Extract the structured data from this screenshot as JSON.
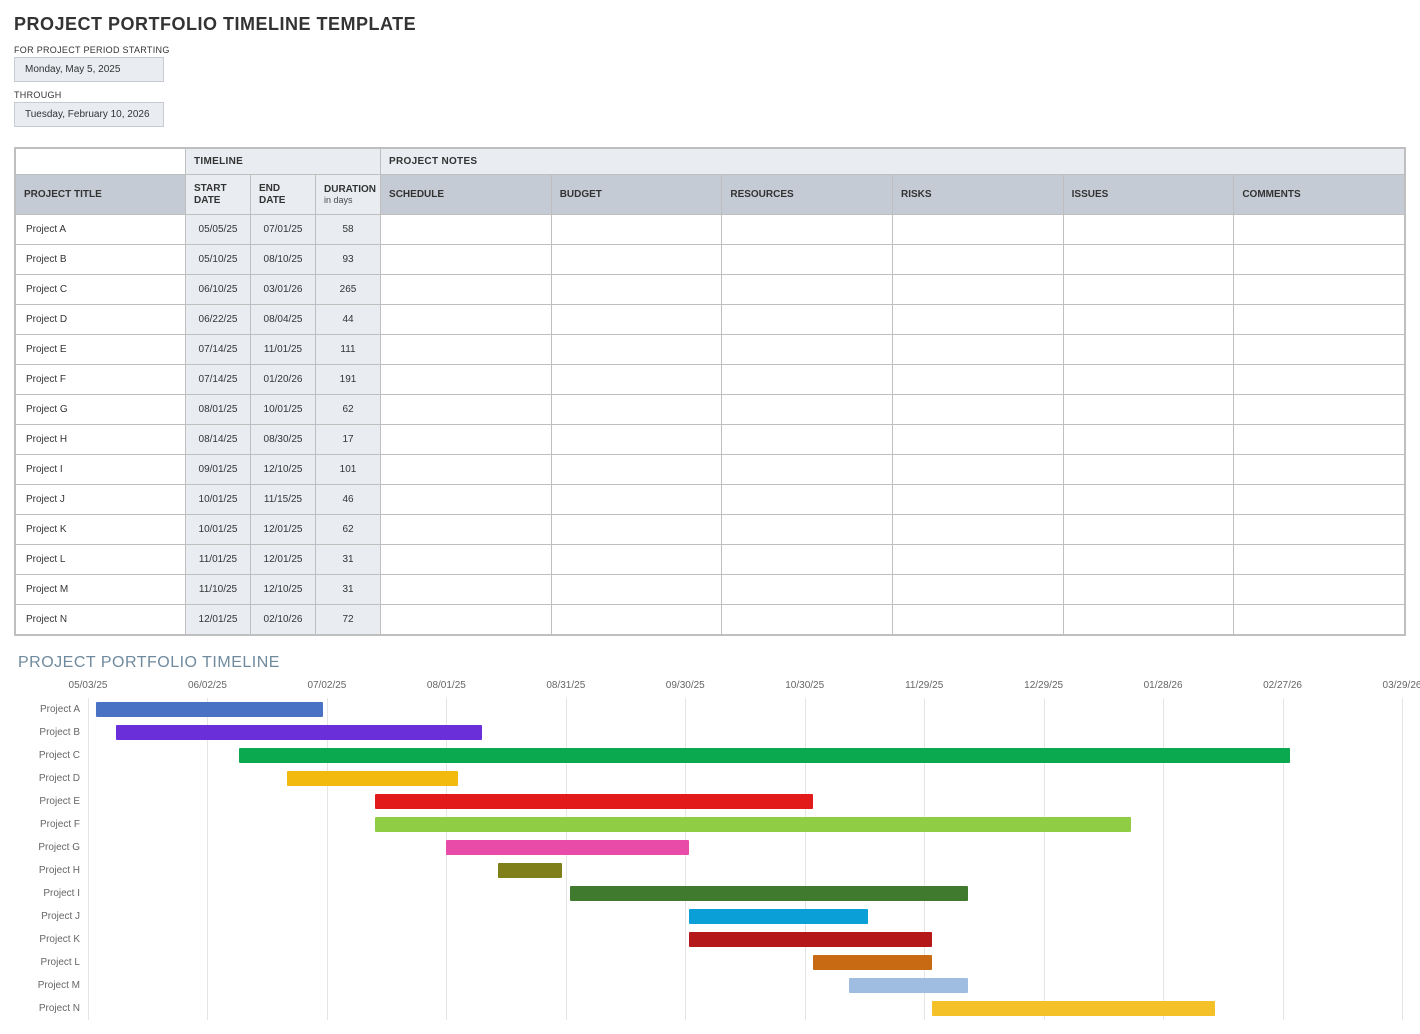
{
  "header": {
    "title": "PROJECT PORTFOLIO TIMELINE TEMPLATE",
    "period_label_start": "FOR PROJECT PERIOD STARTING",
    "period_start": "Monday, May 5, 2025",
    "period_label_through": "THROUGH",
    "period_end": "Tuesday, February 10, 2026"
  },
  "table": {
    "group_headers": {
      "timeline": "TIMELINE",
      "notes": "PROJECT NOTES"
    },
    "col_headers": {
      "project_title": "PROJECT TITLE",
      "start_date": "START DATE",
      "end_date": "END DATE",
      "duration": "DURATION",
      "duration_sub": "in days",
      "schedule": "SCHEDULE",
      "budget": "BUDGET",
      "resources": "RESOURCES",
      "risks": "RISKS",
      "issues": "ISSUES",
      "comments": "COMMENTS"
    },
    "rows": [
      {
        "title": "Project A",
        "start": "05/05/25",
        "end": "07/01/25",
        "duration": "58"
      },
      {
        "title": "Project B",
        "start": "05/10/25",
        "end": "08/10/25",
        "duration": "93"
      },
      {
        "title": "Project C",
        "start": "06/10/25",
        "end": "03/01/26",
        "duration": "265"
      },
      {
        "title": "Project D",
        "start": "06/22/25",
        "end": "08/04/25",
        "duration": "44"
      },
      {
        "title": "Project E",
        "start": "07/14/25",
        "end": "11/01/25",
        "duration": "111"
      },
      {
        "title": "Project F",
        "start": "07/14/25",
        "end": "01/20/26",
        "duration": "191"
      },
      {
        "title": "Project G",
        "start": "08/01/25",
        "end": "10/01/25",
        "duration": "62"
      },
      {
        "title": "Project H",
        "start": "08/14/25",
        "end": "08/30/25",
        "duration": "17"
      },
      {
        "title": "Project I",
        "start": "09/01/25",
        "end": "12/10/25",
        "duration": "101"
      },
      {
        "title": "Project J",
        "start": "10/01/25",
        "end": "11/15/25",
        "duration": "46"
      },
      {
        "title": "Project K",
        "start": "10/01/25",
        "end": "12/01/25",
        "duration": "62"
      },
      {
        "title": "Project L",
        "start": "11/01/25",
        "end": "12/01/25",
        "duration": "31"
      },
      {
        "title": "Project M",
        "start": "11/10/25",
        "end": "12/10/25",
        "duration": "31"
      },
      {
        "title": "Project N",
        "start": "12/01/25",
        "end": "02/10/26",
        "duration": "72"
      }
    ]
  },
  "chart_data": {
    "type": "bar",
    "title": "PROJECT PORTFOLIO TIMELINE",
    "orientation": "horizontal-gantt",
    "x_axis": {
      "start_date": "2025-05-03",
      "end_date": "2026-03-29",
      "ticks": [
        "05/03/25",
        "06/02/25",
        "07/02/25",
        "08/01/25",
        "08/31/25",
        "09/30/25",
        "10/30/25",
        "11/29/25",
        "12/29/25",
        "01/28/26",
        "02/27/26",
        "03/29/26"
      ]
    },
    "series": [
      {
        "name": "Project A",
        "start": "2025-05-05",
        "end": "2025-07-01",
        "color": "#4a72c4"
      },
      {
        "name": "Project B",
        "start": "2025-05-10",
        "end": "2025-08-10",
        "color": "#6a2fd9"
      },
      {
        "name": "Project C",
        "start": "2025-06-10",
        "end": "2026-03-01",
        "color": "#0aa84f"
      },
      {
        "name": "Project D",
        "start": "2025-06-22",
        "end": "2025-08-04",
        "color": "#f2b90f"
      },
      {
        "name": "Project E",
        "start": "2025-07-14",
        "end": "2025-11-01",
        "color": "#e31a1a"
      },
      {
        "name": "Project F",
        "start": "2025-07-14",
        "end": "2026-01-20",
        "color": "#8fce44"
      },
      {
        "name": "Project G",
        "start": "2025-08-01",
        "end": "2025-10-01",
        "color": "#e84ba8"
      },
      {
        "name": "Project H",
        "start": "2025-08-14",
        "end": "2025-08-30",
        "color": "#80801b"
      },
      {
        "name": "Project I",
        "start": "2025-09-01",
        "end": "2025-12-10",
        "color": "#3f7a2e"
      },
      {
        "name": "Project J",
        "start": "2025-10-01",
        "end": "2025-11-15",
        "color": "#0aa0d7"
      },
      {
        "name": "Project K",
        "start": "2025-10-01",
        "end": "2025-12-01",
        "color": "#b51818"
      },
      {
        "name": "Project L",
        "start": "2025-11-01",
        "end": "2025-12-01",
        "color": "#c86a14"
      },
      {
        "name": "Project M",
        "start": "2025-11-10",
        "end": "2025-12-10",
        "color": "#9fbde0"
      },
      {
        "name": "Project N",
        "start": "2025-12-01",
        "end": "2026-02-10",
        "color": "#f4c128"
      }
    ]
  }
}
